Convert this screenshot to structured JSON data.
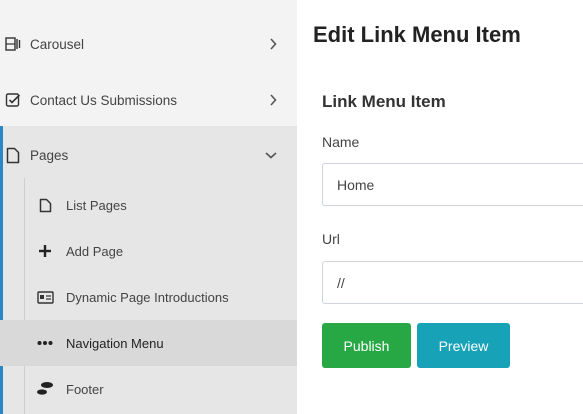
{
  "sidebar": {
    "top_items": [
      {
        "label": "Carousel",
        "icon": "carousel-icon",
        "chevron": "right"
      },
      {
        "label": "Contact Us Submissions",
        "icon": "checkbox-icon",
        "chevron": "right"
      }
    ],
    "pages": {
      "label": "Pages",
      "icon": "file-icon",
      "chevron": "down"
    },
    "sub_items": [
      {
        "label": "List Pages",
        "icon": "file-icon"
      },
      {
        "label": "Add Page",
        "icon": "plus-icon"
      },
      {
        "label": "Dynamic Page Introductions",
        "icon": "id-card-icon"
      },
      {
        "label": "Navigation Menu",
        "icon": "ellipsis-icon",
        "active": true
      },
      {
        "label": "Footer",
        "icon": "shoe-prints-icon"
      }
    ],
    "accent_color": "#2b86c5"
  },
  "main": {
    "title": "Edit Link Menu Item",
    "section_title": "Link Menu Item",
    "fields": {
      "name": {
        "label": "Name",
        "value": "Home"
      },
      "url": {
        "label": "Url",
        "value": "//"
      }
    },
    "buttons": {
      "publish": "Publish",
      "preview": "Preview"
    },
    "colors": {
      "publish": "#28a745",
      "preview": "#17a2b8"
    }
  }
}
